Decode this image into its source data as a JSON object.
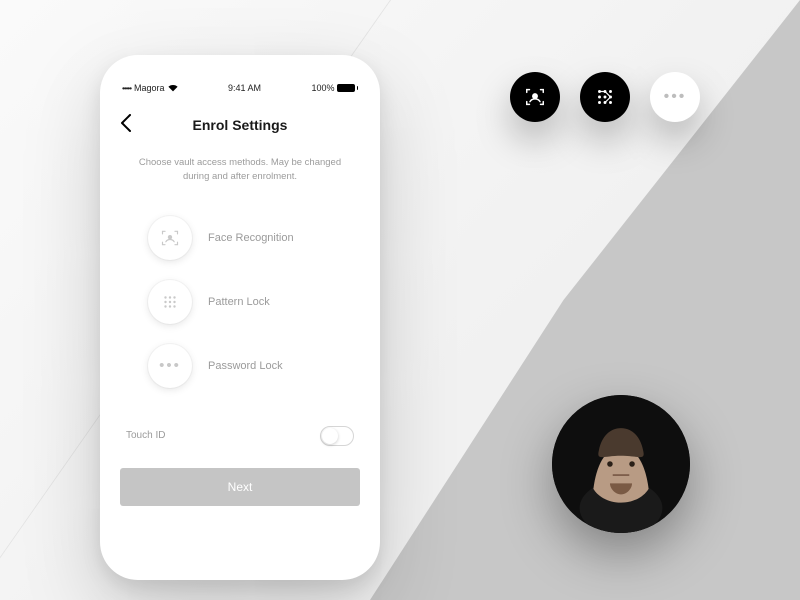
{
  "statusbar": {
    "carrier": "Magora",
    "time": "9:41 AM",
    "battery": "100%"
  },
  "nav": {
    "title": "Enrol Settings"
  },
  "intro": "Choose vault access methods. May be changed during and after enrolment.",
  "options": [
    {
      "label": "Face Recognition"
    },
    {
      "label": "Pattern Lock"
    },
    {
      "label": "Password Lock"
    }
  ],
  "touchid": {
    "label": "Touch ID",
    "on": false
  },
  "cta": {
    "next": "Next"
  }
}
